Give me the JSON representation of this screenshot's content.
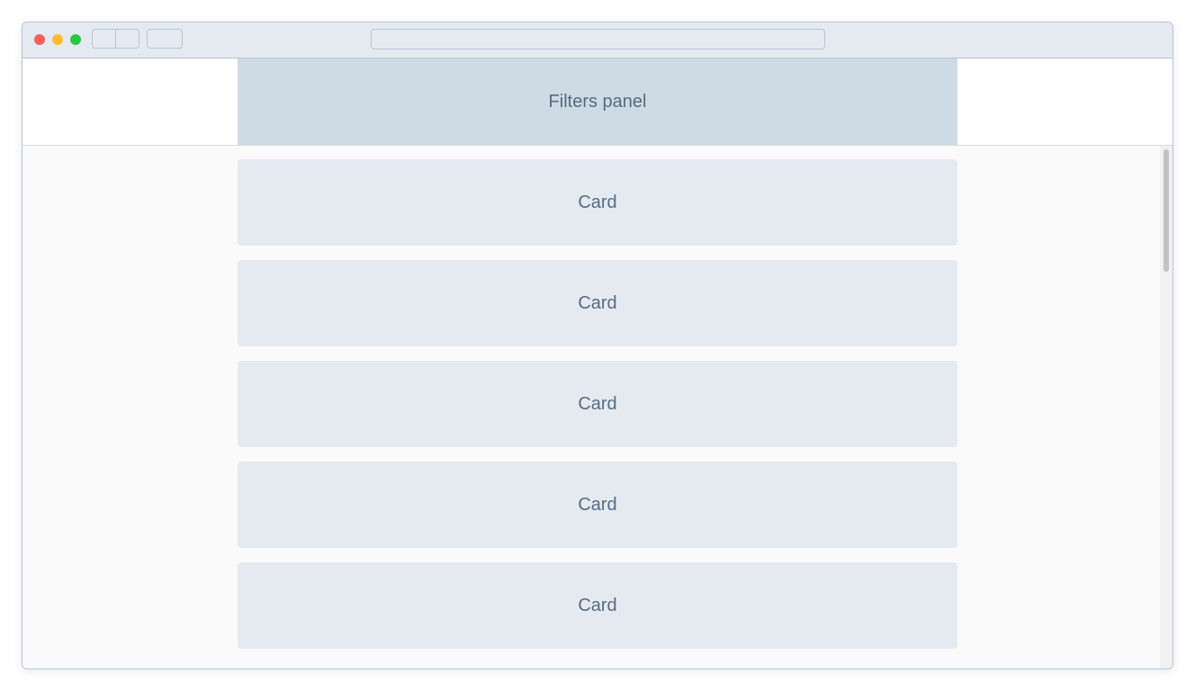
{
  "browser": {
    "address": ""
  },
  "header": {
    "filters_label": "Filters panel"
  },
  "cards": [
    {
      "label": "Card"
    },
    {
      "label": "Card"
    },
    {
      "label": "Card"
    },
    {
      "label": "Card"
    },
    {
      "label": "Card"
    }
  ],
  "scroll": {
    "position_fraction": 0.0
  }
}
